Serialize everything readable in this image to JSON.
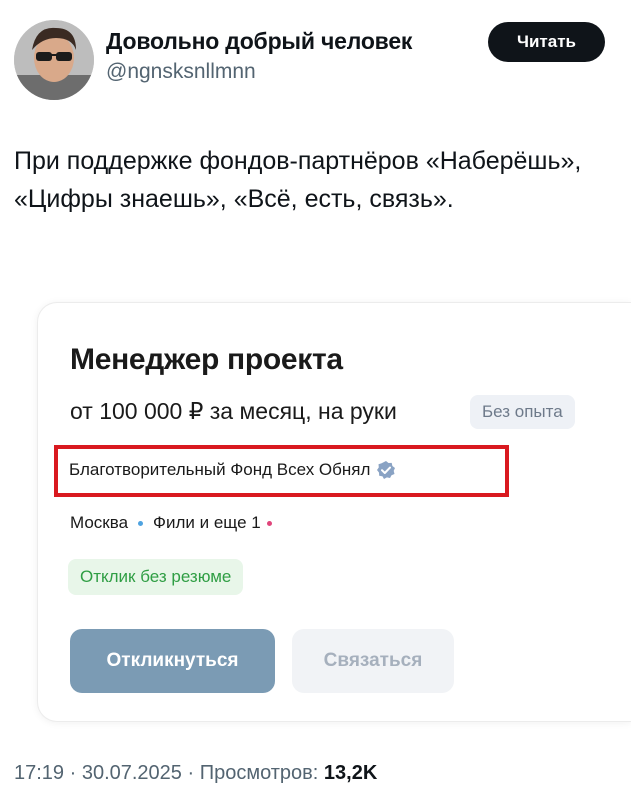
{
  "author": {
    "display_name": "Довольно добрый человек",
    "handle": "@ngnsksnllmnn",
    "follow_label": "Читать"
  },
  "tweet": {
    "text": "При поддержке фондов-партнёров «Наберёшь», «Цифры знаешь», «Всё, есть, связь»."
  },
  "job_card": {
    "title": "Менеджер проекта",
    "salary": "от 100 000 ₽ за месяц, на руки",
    "experience_badge": "Без опыта",
    "company": "Благотворительный Фонд Всех Обнял",
    "city": "Москва",
    "metro": "Фили и еще 1",
    "resume_badge": "Отклик без резюме",
    "apply_label": "Откликнуться",
    "contact_label": "Связаться",
    "colors": {
      "highlight_box": "#d9191f",
      "verified": "#8aa3c4",
      "metro_dot_1": "#4fa3e0",
      "metro_dot_2": "#e0457b",
      "apply_bg": "#7b9bb4"
    }
  },
  "meta": {
    "time_date": "17:19 · 30.07.2025 · Просмотров:",
    "views": "13,2K"
  }
}
